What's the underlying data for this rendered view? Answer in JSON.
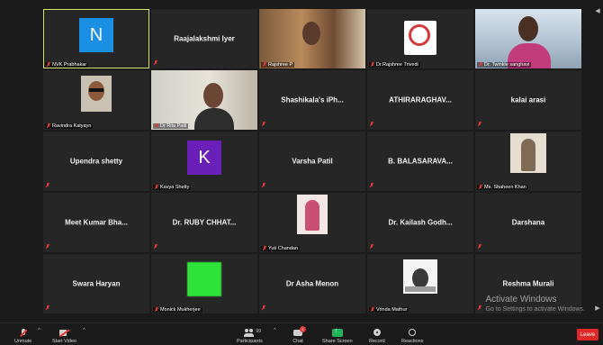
{
  "tiles": [
    {
      "name": "NVK Prabhakar",
      "type": "avatar",
      "letter": "N",
      "color": "#1a8fe3",
      "active": true
    },
    {
      "name": "Raajalakshmi Iyer",
      "type": "name"
    },
    {
      "name": "Rajshree P",
      "type": "photo",
      "photo": "rajshree"
    },
    {
      "name": "Dr.Rajshree Trivedi",
      "type": "photo",
      "photo": "logo"
    },
    {
      "name": "Dr. Twinkle sanghavi",
      "type": "photo",
      "photo": "twinkle"
    },
    {
      "name": "Ravindra Katyayn",
      "type": "photo",
      "photo": "ravindra"
    },
    {
      "name": "Dr Rita Patil",
      "type": "photo",
      "photo": "rita"
    },
    {
      "name": "Shashikala's iPh...",
      "type": "name"
    },
    {
      "name": "ATHIRARAGHAV...",
      "type": "name"
    },
    {
      "name": "kalai arasi",
      "type": "name"
    },
    {
      "name": "Upendra shetty",
      "type": "name"
    },
    {
      "name": "Kavya Shetty",
      "type": "avatar",
      "letter": "K",
      "color": "#6a1fb8"
    },
    {
      "name": "Varsha Patil",
      "type": "name"
    },
    {
      "name": "B. BALASARAVA...",
      "type": "name"
    },
    {
      "name": "Ms. Shaheen Khan",
      "type": "photo",
      "photo": "shaheen"
    },
    {
      "name": "Meet Kumar Bha...",
      "type": "name"
    },
    {
      "name": "Dr. RUBY CHHAT...",
      "type": "name"
    },
    {
      "name": "Yuti Chandan",
      "type": "photo",
      "photo": "yuti"
    },
    {
      "name": "Dr. Kailash Godh...",
      "type": "name"
    },
    {
      "name": "Darshana",
      "type": "name"
    },
    {
      "name": "Swara Haryan",
      "type": "name"
    },
    {
      "name": "Monick Mukherjee",
      "type": "photo",
      "photo": "monick"
    },
    {
      "name": "Dr Asha Menon",
      "type": "name"
    },
    {
      "name": "Vrinda Mathur",
      "type": "photo",
      "photo": "vrinda"
    },
    {
      "name": "Reshma Murali",
      "type": "name"
    }
  ],
  "watermark": {
    "title": "Activate Windows",
    "subtitle": "Go to Settings to activate Windows."
  },
  "toolbar": {
    "unmute": "Unmute",
    "start_video": "Start Video",
    "participants": "Participants",
    "participants_count": "99",
    "chat": "Chat",
    "chat_badge": "1",
    "share_screen": "Share Screen",
    "record": "Record",
    "reactions": "Reactions",
    "leave": "Leave"
  },
  "colors": {
    "accent_green": "#1fb35a",
    "leave_red": "#e02828",
    "active_outline": "#d6e36a"
  }
}
